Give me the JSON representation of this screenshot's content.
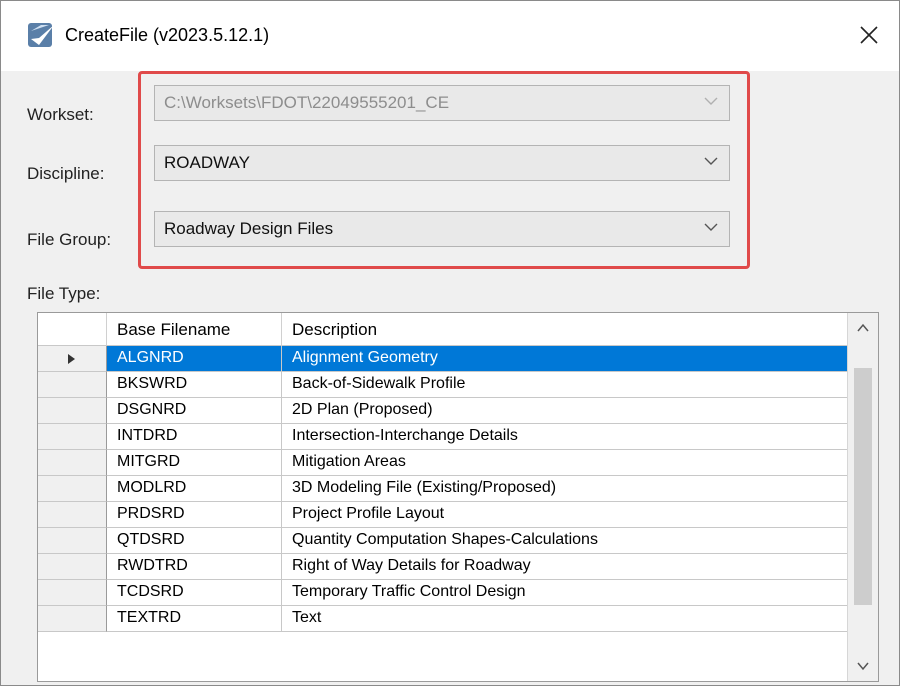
{
  "window": {
    "title": "CreateFile (v2023.5.12.1)",
    "icons": {
      "app": "createfile-app-icon",
      "close": "close-icon"
    }
  },
  "form": {
    "workset": {
      "label": "Workset:",
      "value": "C:\\Worksets\\FDOT\\22049555201_CE",
      "enabled": false
    },
    "discipline": {
      "label": "Discipline:",
      "value": "ROADWAY"
    },
    "file_group": {
      "label": "File Group:",
      "value": "Roadway Design Files"
    },
    "file_type_label": "File Type:"
  },
  "grid": {
    "columns": [
      "Base Filename",
      "Description"
    ],
    "selected_index": 0,
    "rows": [
      {
        "base": "ALGNRD",
        "desc": "Alignment Geometry"
      },
      {
        "base": "BKSWRD",
        "desc": "Back-of-Sidewalk Profile"
      },
      {
        "base": "DSGNRD",
        "desc": "2D Plan (Proposed)"
      },
      {
        "base": "INTDRD",
        "desc": "Intersection-Interchange Details"
      },
      {
        "base": "MITGRD",
        "desc": "Mitigation Areas"
      },
      {
        "base": "MODLRD",
        "desc": "3D Modeling File (Existing/Proposed)"
      },
      {
        "base": "PRDSRD",
        "desc": "Project Profile Layout"
      },
      {
        "base": "QTDSRD",
        "desc": "Quantity Computation Shapes-Calculations"
      },
      {
        "base": "RWDTRD",
        "desc": "Right of Way Details for Roadway"
      },
      {
        "base": "TCDSRD",
        "desc": "Temporary Traffic Control Design"
      },
      {
        "base": "TEXTRD",
        "desc": "Text"
      }
    ]
  },
  "colors": {
    "highlight_box": "#e04a4a",
    "selection": "#0078d7"
  }
}
